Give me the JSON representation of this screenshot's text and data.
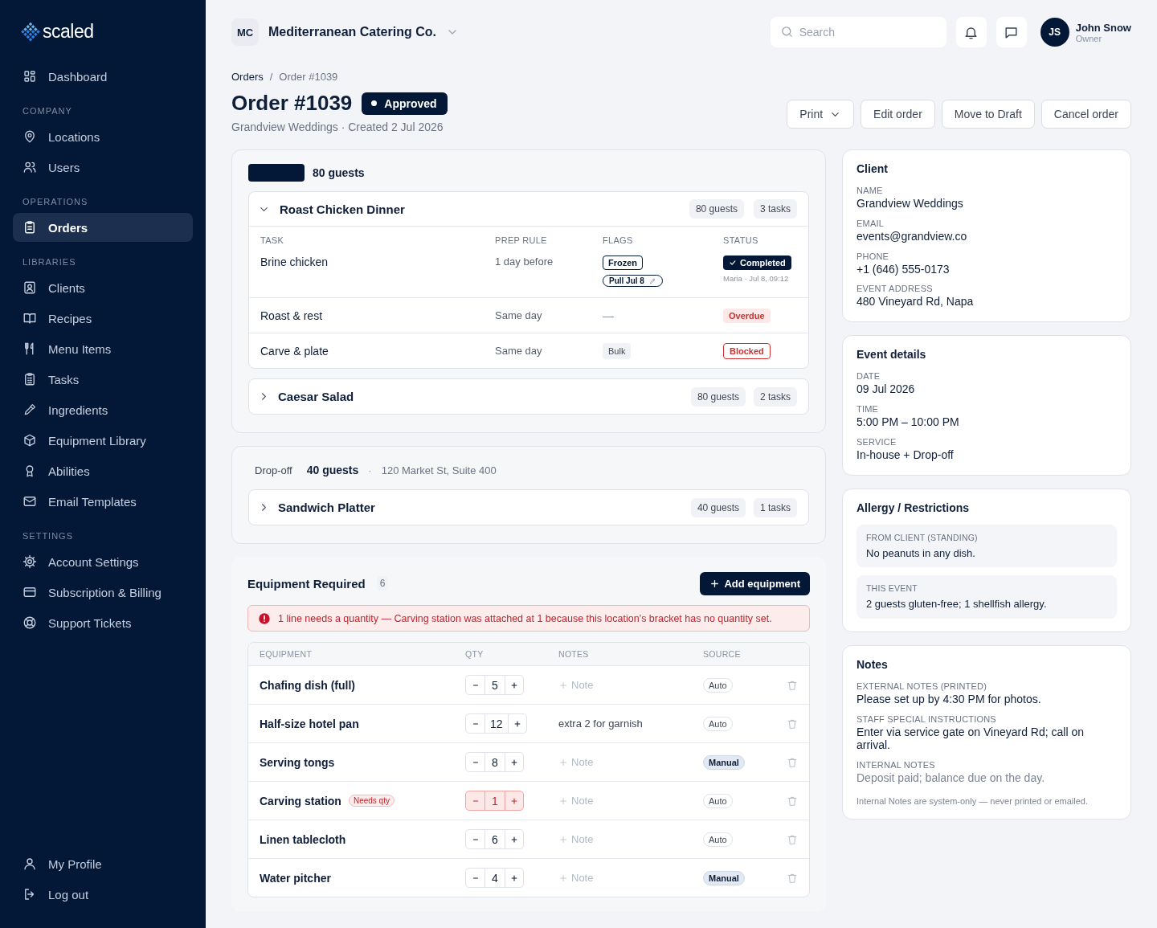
{
  "sidebar": {
    "logo": "scaled",
    "groups": [
      {
        "items": [
          {
            "label": "Dashboard",
            "selected": false
          }
        ]
      },
      {
        "heading": "COMPANY",
        "items": [
          {
            "label": "Locations",
            "selected": false
          },
          {
            "label": "Users",
            "selected": false
          }
        ]
      },
      {
        "heading": "OPERATIONS",
        "items": [
          {
            "label": "Orders",
            "selected": true
          }
        ]
      },
      {
        "heading": "LIBRARIES",
        "items": [
          {
            "label": "Clients",
            "selected": false
          },
          {
            "label": "Recipes",
            "selected": false
          },
          {
            "label": "Menu Items",
            "selected": false
          },
          {
            "label": "Tasks",
            "selected": false
          },
          {
            "label": "Ingredients",
            "selected": false
          },
          {
            "label": "Equipment Library",
            "selected": false
          },
          {
            "label": "Abilities",
            "selected": false
          },
          {
            "label": "Email Templates",
            "selected": false
          }
        ]
      },
      {
        "heading": "SETTINGS",
        "items": [
          {
            "label": "Account Settings",
            "selected": false
          },
          {
            "label": "Subscription & Billing",
            "selected": false
          },
          {
            "label": "Support Tickets",
            "selected": false
          }
        ]
      }
    ],
    "footer": [
      {
        "label": "My Profile",
        "selected": false
      },
      {
        "label": "Log out",
        "selected": false
      }
    ]
  },
  "topbar": {
    "org_initials": "MC",
    "org_name": "Mediterranean Catering Co.",
    "search": {
      "placeholder": "Search"
    },
    "user": {
      "initials": "JS",
      "name": "John Snow",
      "role": "Owner"
    }
  },
  "breadcrumb": {
    "items": [
      "Orders",
      "Order #1039"
    ],
    "separator": "/"
  },
  "order": {
    "title": "Order #1039",
    "status": "Approved",
    "subtitle": "Grandview Weddings · Created 2 Jul 2026"
  },
  "actions": [
    {
      "label": "Print",
      "kind": "dropdown"
    },
    {
      "label": "Edit order",
      "kind": "button"
    },
    {
      "label": "Move to Draft",
      "kind": "button"
    },
    {
      "label": "Cancel order",
      "kind": "button"
    }
  ],
  "services": [
    {
      "kind": "blank-tag",
      "guests": "80 guests",
      "dishes": [
        {
          "name": "Roast Chicken Dinner",
          "expanded": true,
          "guests": "80 guests",
          "tasks": "3 tasks",
          "columns": [
            "TASK",
            "PREP RULE",
            "FLAGS",
            "STATUS"
          ],
          "rows": [
            {
              "task": "Brine chicken",
              "prep_rule": "1 day before",
              "flags": [
                {
                  "label": "Frozen",
                  "kind": "outline"
                },
                {
                  "label": "Pull Jul 8",
                  "kind": "editable"
                }
              ],
              "status": {
                "label": "Completed",
                "kind": "completed",
                "meta": "Maria · Jul 8, 09:12"
              }
            },
            {
              "task": "Roast & rest",
              "prep_rule": "Same day",
              "flags": [
                {
                  "label": "—",
                  "kind": "none"
                }
              ],
              "status": {
                "label": "Overdue",
                "kind": "overdue"
              }
            },
            {
              "task": "Carve & plate",
              "prep_rule": "Same day",
              "flags": [
                {
                  "label": "Bulk",
                  "kind": "plain"
                }
              ],
              "status": {
                "label": "Blocked",
                "kind": "blocked"
              }
            }
          ]
        },
        {
          "name": "Caesar Salad",
          "expanded": false,
          "guests": "80 guests",
          "tasks": "2 tasks"
        }
      ]
    },
    {
      "kind": "labelled",
      "label": "Drop-off",
      "guests": "40 guests",
      "separator": "·",
      "address": "120 Market St, Suite 400",
      "dishes": [
        {
          "name": "Sandwich Platter",
          "expanded": false,
          "guests": "40 guests",
          "tasks": "1 tasks"
        }
      ]
    }
  ],
  "equipment": {
    "title": "Equipment Required",
    "count": "6",
    "add_button": "Add equipment",
    "alert": "1 line needs a quantity — Carving station was attached at 1 because this location’s bracket has no quantity set.",
    "columns": [
      "EQUIPMENT",
      "QTY",
      "NOTES",
      "SOURCE"
    ],
    "rows": [
      {
        "name": "Chafing dish (full)",
        "qty": "5",
        "needs_qty": false,
        "note": {
          "kind": "add",
          "label": "Note"
        },
        "source": {
          "label": "Auto",
          "kind": "auto"
        }
      },
      {
        "name": "Half-size hotel pan",
        "qty": "12",
        "needs_qty": false,
        "note": {
          "kind": "text",
          "label": "extra 2 for garnish"
        },
        "source": {
          "label": "Auto",
          "kind": "auto"
        }
      },
      {
        "name": "Serving tongs",
        "qty": "8",
        "needs_qty": false,
        "note": {
          "kind": "add",
          "label": "Note"
        },
        "source": {
          "label": "Manual",
          "kind": "manual"
        }
      },
      {
        "name": "Carving station",
        "tag": "Needs qty",
        "qty": "1",
        "needs_qty": true,
        "note": {
          "kind": "add",
          "label": "Note"
        },
        "source": {
          "label": "Auto",
          "kind": "auto"
        }
      },
      {
        "name": "Linen tablecloth",
        "qty": "6",
        "needs_qty": false,
        "note": {
          "kind": "add",
          "label": "Note"
        },
        "source": {
          "label": "Auto",
          "kind": "auto"
        }
      },
      {
        "name": "Water pitcher",
        "qty": "4",
        "needs_qty": false,
        "note": {
          "kind": "add",
          "label": "Note"
        },
        "source": {
          "label": "Manual",
          "kind": "manual"
        }
      }
    ]
  },
  "panels": [
    {
      "kind": "fields",
      "title": "Client",
      "fields": [
        {
          "label": "NAME",
          "value": "Grandview Weddings",
          "muted": false
        },
        {
          "label": "EMAIL",
          "value": "events@grandview.co",
          "muted": false
        },
        {
          "label": "PHONE",
          "value": "+1 (646) 555-0173",
          "muted": false
        },
        {
          "label": "EVENT ADDRESS",
          "value": "480 Vineyard Rd, Napa",
          "muted": false
        }
      ]
    },
    {
      "kind": "fields",
      "title": "Event details",
      "fields": [
        {
          "label": "DATE",
          "value": "09 Jul 2026",
          "muted": false
        },
        {
          "label": "TIME",
          "value": "5:00 PM – 10:00 PM",
          "muted": false
        },
        {
          "label": "SERVICE",
          "value": "In-house + Drop-off",
          "muted": false
        }
      ]
    },
    {
      "kind": "blocks",
      "title": "Allergy / Restrictions",
      "fields": [
        {
          "label": "FROM CLIENT (STANDING)",
          "value": "No peanuts in any dish."
        },
        {
          "label": "THIS EVENT",
          "value": "2 guests gluten-free; 1 shellfish allergy."
        }
      ]
    },
    {
      "kind": "fields",
      "title": "Notes",
      "fields": [
        {
          "label": "EXTERNAL NOTES (PRINTED)",
          "value": "Please set up by 4:30 PM for photos.",
          "muted": false
        },
        {
          "label": "STAFF SPECIAL INSTRUCTIONS",
          "value": "Enter via service gate on Vineyard Rd; call on arrival.",
          "muted": false
        },
        {
          "label": "INTERNAL NOTES",
          "value": "Deposit paid; balance due on the day.",
          "muted": true
        }
      ],
      "footnote": "Internal Notes are system-only — never printed or emailed."
    }
  ]
}
